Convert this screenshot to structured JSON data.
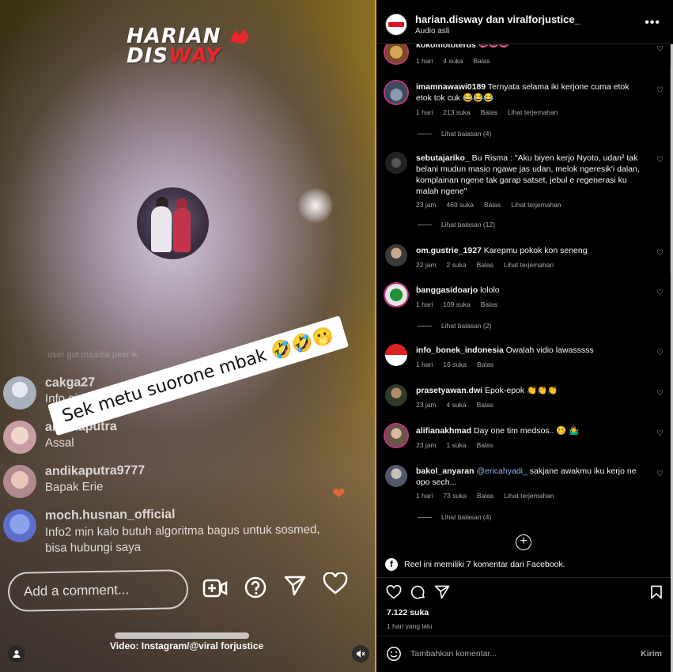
{
  "video": {
    "logo_line1": "HARIAN",
    "logo_line2_white": "DIS",
    "logo_line2_red": "WAY",
    "faint_text": "user got maādla pesr  ik",
    "live_comments": [
      {
        "user": "cakga27",
        "text": "Info giveaway tiket pa"
      },
      {
        "user": "andikaputra",
        "text": "Assal"
      },
      {
        "user": "andikaputra9777",
        "text": "Bapak Erie"
      },
      {
        "user": "moch.husnan_official",
        "text": "Info2 min kalo butuh algoritma bagus untuk sosmed, bisa hubungi saya"
      }
    ],
    "overlay_text": "Sek metu suorone mbak 🤣🤣🫢",
    "comment_placeholder": "Add a comment...",
    "watermark": "Video: Instagram/@viral forjustice",
    "colors": {
      "logo_red": "#e8262b",
      "heart": "#e8643c"
    }
  },
  "header": {
    "title": "harian.disway dan viralforjustice_",
    "subtitle": "Audio asli",
    "more": "•••"
  },
  "comments": [
    {
      "user": "kokomototerus",
      "text": "👄👄👄",
      "time": "1 hari",
      "likes": "4 suka",
      "reply": "Balas",
      "translate": ""
    },
    {
      "user": "imamnawawi0189",
      "text": "Ternyata selama iki kerjone cuma etok etok tok cuk 😂😂😂",
      "time": "1 hari",
      "likes": "213 suka",
      "reply": "Balas",
      "translate": "Lihat terjemahan",
      "replies": "Lihat balasan (4)"
    },
    {
      "user": "sebutajariko_",
      "text": "Bu Risma : \"Aku biyen kerjo Nyoto, udan² tak belani mudun masio ngawe jas udan, melok ngeresik'i dalan, komplainan ngene tak garap satset, jebul e regenerasi ku malah ngene\"",
      "time": "23 jam",
      "likes": "469 suka",
      "reply": "Balas",
      "translate": "Lihat terjemahan",
      "replies": "Lihat balasan (12)"
    },
    {
      "user": "om.gustrie_1927",
      "text": "Karepmu pokok kon seneng",
      "time": "22 jam",
      "likes": "2 suka",
      "reply": "Balas",
      "translate": "Lihat terjemahan"
    },
    {
      "user": "banggasidoarjo",
      "text": "lololo",
      "time": "1 hari",
      "likes": "109 suka",
      "reply": "Balas",
      "translate": "",
      "replies": "Lihat balasan (2)"
    },
    {
      "user": "info_bonek_indonesia",
      "text": "Owalah vidio lawasssss",
      "time": "1 hari",
      "likes": "16 suka",
      "reply": "Balas",
      "translate": ""
    },
    {
      "user": "prasetyawan.dwi",
      "text": "Epok-epok 👏👏👏",
      "time": "23 jam",
      "likes": "4 suka",
      "reply": "Balas",
      "translate": ""
    },
    {
      "user": "alifianakhmad",
      "text": "Day one tim medsos.. 🥴 🤷‍♂️",
      "time": "23 jam",
      "likes": "1 suka",
      "reply": "Balas",
      "translate": ""
    },
    {
      "user": "bakol_anyaran",
      "mention": "@ericahyadi_",
      "text": "sakjane awakmu iku kerjo ne opo sech...",
      "time": "1 hari",
      "likes": "73 suka",
      "reply": "Balas",
      "translate": "Lihat terjemahan",
      "replies": "Lihat balasan (4)"
    }
  ],
  "fb_note": "Reel ini memiliki 7 komentar dari Facebook.",
  "likes_count": "7.122 suka",
  "posted_ago": "1 hari yang lalu",
  "add_comment_placeholder": "Tambahkan komentar...",
  "send_label": "Kirim",
  "icons": [
    "heart-icon",
    "comment-icon",
    "share-icon",
    "bookmark-icon",
    "emoji-icon",
    "plus-circle-icon",
    "facebook-icon",
    "mute-icon",
    "user-icon"
  ]
}
